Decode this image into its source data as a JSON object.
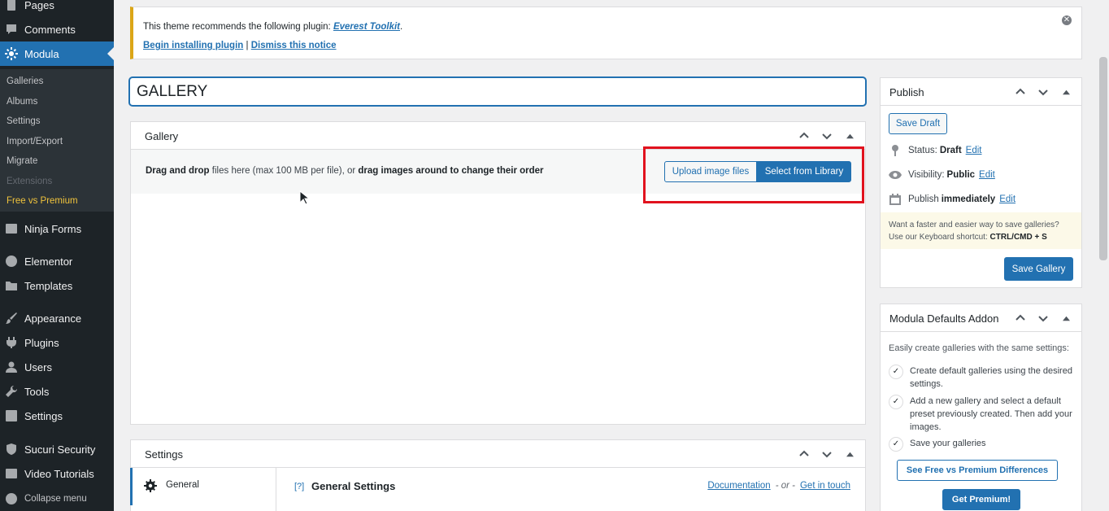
{
  "sidebar": {
    "items": [
      {
        "label": "Pages",
        "icon": "pages-icon"
      },
      {
        "label": "Comments",
        "icon": "comments-icon"
      },
      {
        "label": "Modula",
        "icon": "gear-icon"
      },
      {
        "label": "Ninja Forms",
        "icon": "forms-icon"
      },
      {
        "label": "Elementor",
        "icon": "elementor-icon"
      },
      {
        "label": "Templates",
        "icon": "folder-icon"
      },
      {
        "label": "Appearance",
        "icon": "brush-icon"
      },
      {
        "label": "Plugins",
        "icon": "plug-icon"
      },
      {
        "label": "Users",
        "icon": "user-icon"
      },
      {
        "label": "Tools",
        "icon": "wrench-icon"
      },
      {
        "label": "Settings",
        "icon": "settings-icon"
      },
      {
        "label": "Sucuri Security",
        "icon": "shield-icon"
      },
      {
        "label": "Video Tutorials",
        "icon": "play-icon"
      },
      {
        "label": "Collapse menu",
        "icon": "collapse-icon"
      }
    ],
    "submenu": [
      "Galleries",
      "Albums",
      "Settings",
      "Import/Export",
      "Migrate",
      "Extensions",
      "Free vs Premium"
    ]
  },
  "notice": {
    "text": "This theme recommends the following plugin:",
    "plugin_link": "Everest Toolkit",
    "period": ".",
    "begin_link": "Begin installing plugin",
    "separator": "|",
    "dismiss_link": "Dismiss this notice",
    "close": "✕"
  },
  "title_input": {
    "value": "GALLERY"
  },
  "gallery_box": {
    "title": "Gallery",
    "drop_bold1": "Drag and drop",
    "drop_mid": "files here (max 100 MB per file), or",
    "drop_bold2": "drag images around to change their order",
    "upload_button": "Upload image files",
    "library_button": "Select from Library"
  },
  "settings_box": {
    "title": "Settings",
    "tab_general": "General",
    "help": "[?]",
    "section_title": "General Settings",
    "doc_link": "Documentation",
    "or": "- or -",
    "contact_link": "Get in touch"
  },
  "publish_box": {
    "title": "Publish",
    "save_draft": "Save Draft",
    "status_label": "Status:",
    "status_value": "Draft",
    "visibility_label": "Visibility:",
    "visibility_value": "Public",
    "publish_label": "Publish",
    "publish_value": "immediately",
    "edit": "Edit",
    "note_text": "Want a faster and easier way to save galleries? Use our Keyboard shortcut:",
    "note_shortcut": "CTRL/CMD + S",
    "save_gallery": "Save Gallery"
  },
  "defaults_box": {
    "title": "Modula Defaults Addon",
    "intro": "Easily create galleries with the same settings:",
    "features": [
      "Create default galleries using the desired settings.",
      "Add a new gallery and select a default preset previously created. Then add your images.",
      "Save your galleries"
    ],
    "compare_button": "See Free vs Premium Differences",
    "premium_button": "Get Premium!"
  },
  "colors": {
    "accent": "#2271b1",
    "sidebar": "#1d2327",
    "highlight": "#e1121e",
    "notice": "#dba617"
  }
}
